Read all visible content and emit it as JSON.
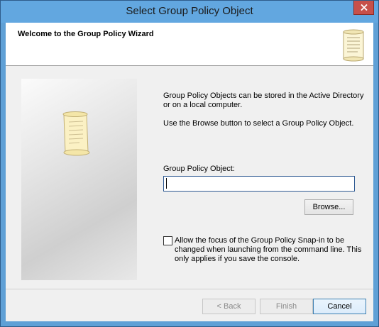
{
  "window": {
    "title": "Select Group Policy Object"
  },
  "header": {
    "title": "Welcome to the Group Policy Wizard",
    "icon": "scroll-icon"
  },
  "body": {
    "description_1": "Group Policy Objects can be stored in the Active Directory or on a local computer.",
    "description_2": "Use the Browse button to select a Group Policy Object.",
    "gpo_label": "Group Policy Object:",
    "gpo_value": "",
    "browse_label": "Browse...",
    "checkbox_label": "Allow the focus of the Group Policy Snap-in to be changed when launching from the command line.  This only applies if you save the console.",
    "checkbox_checked": false
  },
  "footer": {
    "back_label": "< Back",
    "finish_label": "Finish",
    "cancel_label": "Cancel"
  },
  "colors": {
    "titlebar": "#62a7e0",
    "close_button": "#c7504a"
  }
}
